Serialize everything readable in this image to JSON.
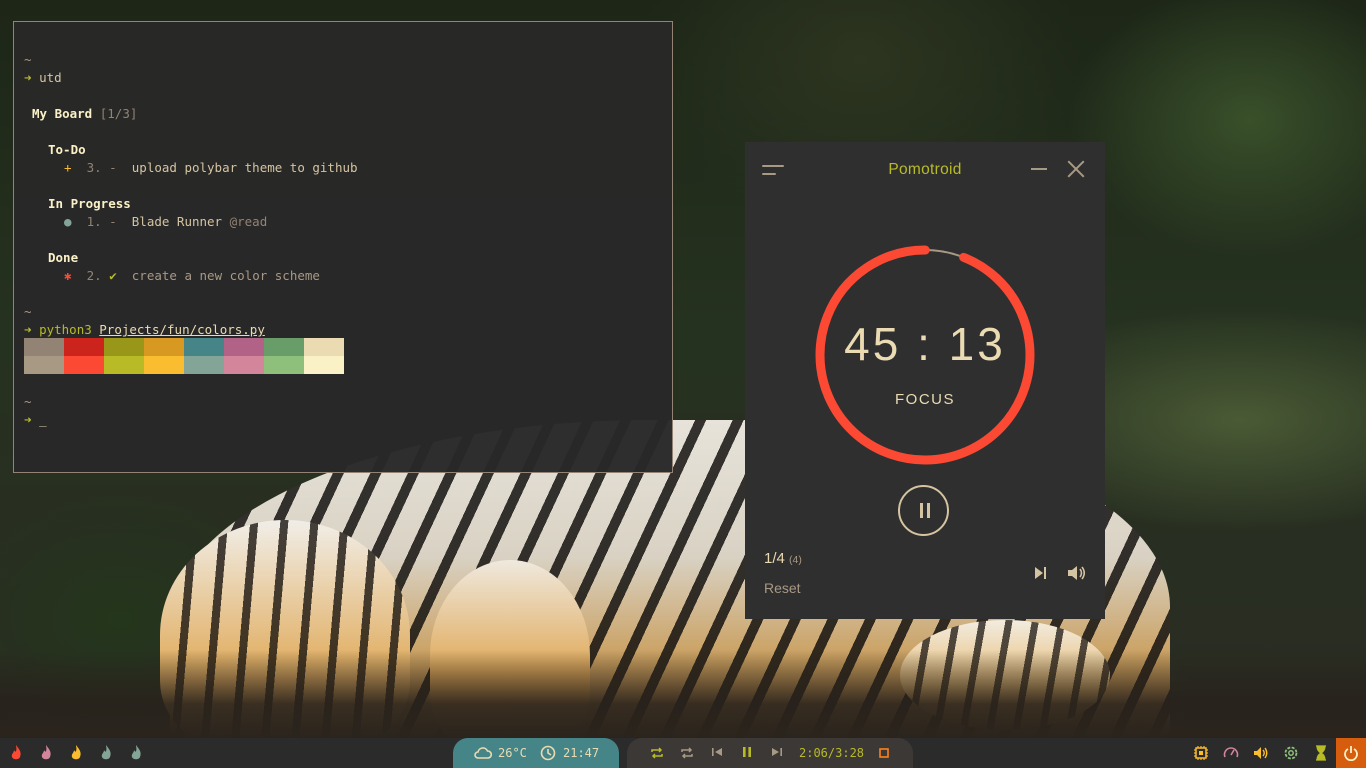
{
  "colors": {
    "accent_yellow": "#b8bb26",
    "pomodoro_red": "#fb4934",
    "weather_pill": "#458588",
    "power_orange": "#d65d0e",
    "palette": [
      [
        "#928374",
        "#a89984"
      ],
      [
        "#cc241d",
        "#fb4934"
      ],
      [
        "#98971a",
        "#b8bb26"
      ],
      [
        "#d79921",
        "#fabd2f"
      ],
      [
        "#458588",
        "#83a598"
      ],
      [
        "#b16286",
        "#d3869b"
      ],
      [
        "#689d6a",
        "#8ec07c"
      ],
      [
        "#ebdbb2",
        "#fbf1c7"
      ]
    ]
  },
  "terminal": {
    "tilde": "~",
    "arrow": "➜",
    "cmd_utd": "utd",
    "board_title": "My Board",
    "board_count": "[1/3]",
    "todo_header": "To-Do",
    "todo_item": {
      "icon": "+",
      "num": "3. -",
      "text": "upload polybar theme to github"
    },
    "inprogress_header": "In Progress",
    "inprogress_item": {
      "icon": "●",
      "num": "1. -",
      "text": "Blade Runner",
      "tag": "@read"
    },
    "done_header": "Done",
    "done_item": {
      "icon": "✱",
      "num": "2.",
      "check": "✔",
      "text": "create a new color scheme"
    },
    "cmd_python": "python3",
    "cmd_python_arg": "Projects/fun/colors.py",
    "cursor": "_"
  },
  "pomotroid": {
    "title": "Pomotroid",
    "time": "45 : 13",
    "phase": "FOCUS",
    "round": "1/4",
    "round_total": "(4)",
    "reset": "Reset",
    "progress_remaining": 0.94
  },
  "statusbar": {
    "workspaces": [
      "flame-pink",
      "flame-magenta",
      "flame-yellow",
      "flame-teal",
      "flame-blue"
    ],
    "temperature": "26°C",
    "clock": "21:47",
    "media_time": "2:06/3:28"
  }
}
